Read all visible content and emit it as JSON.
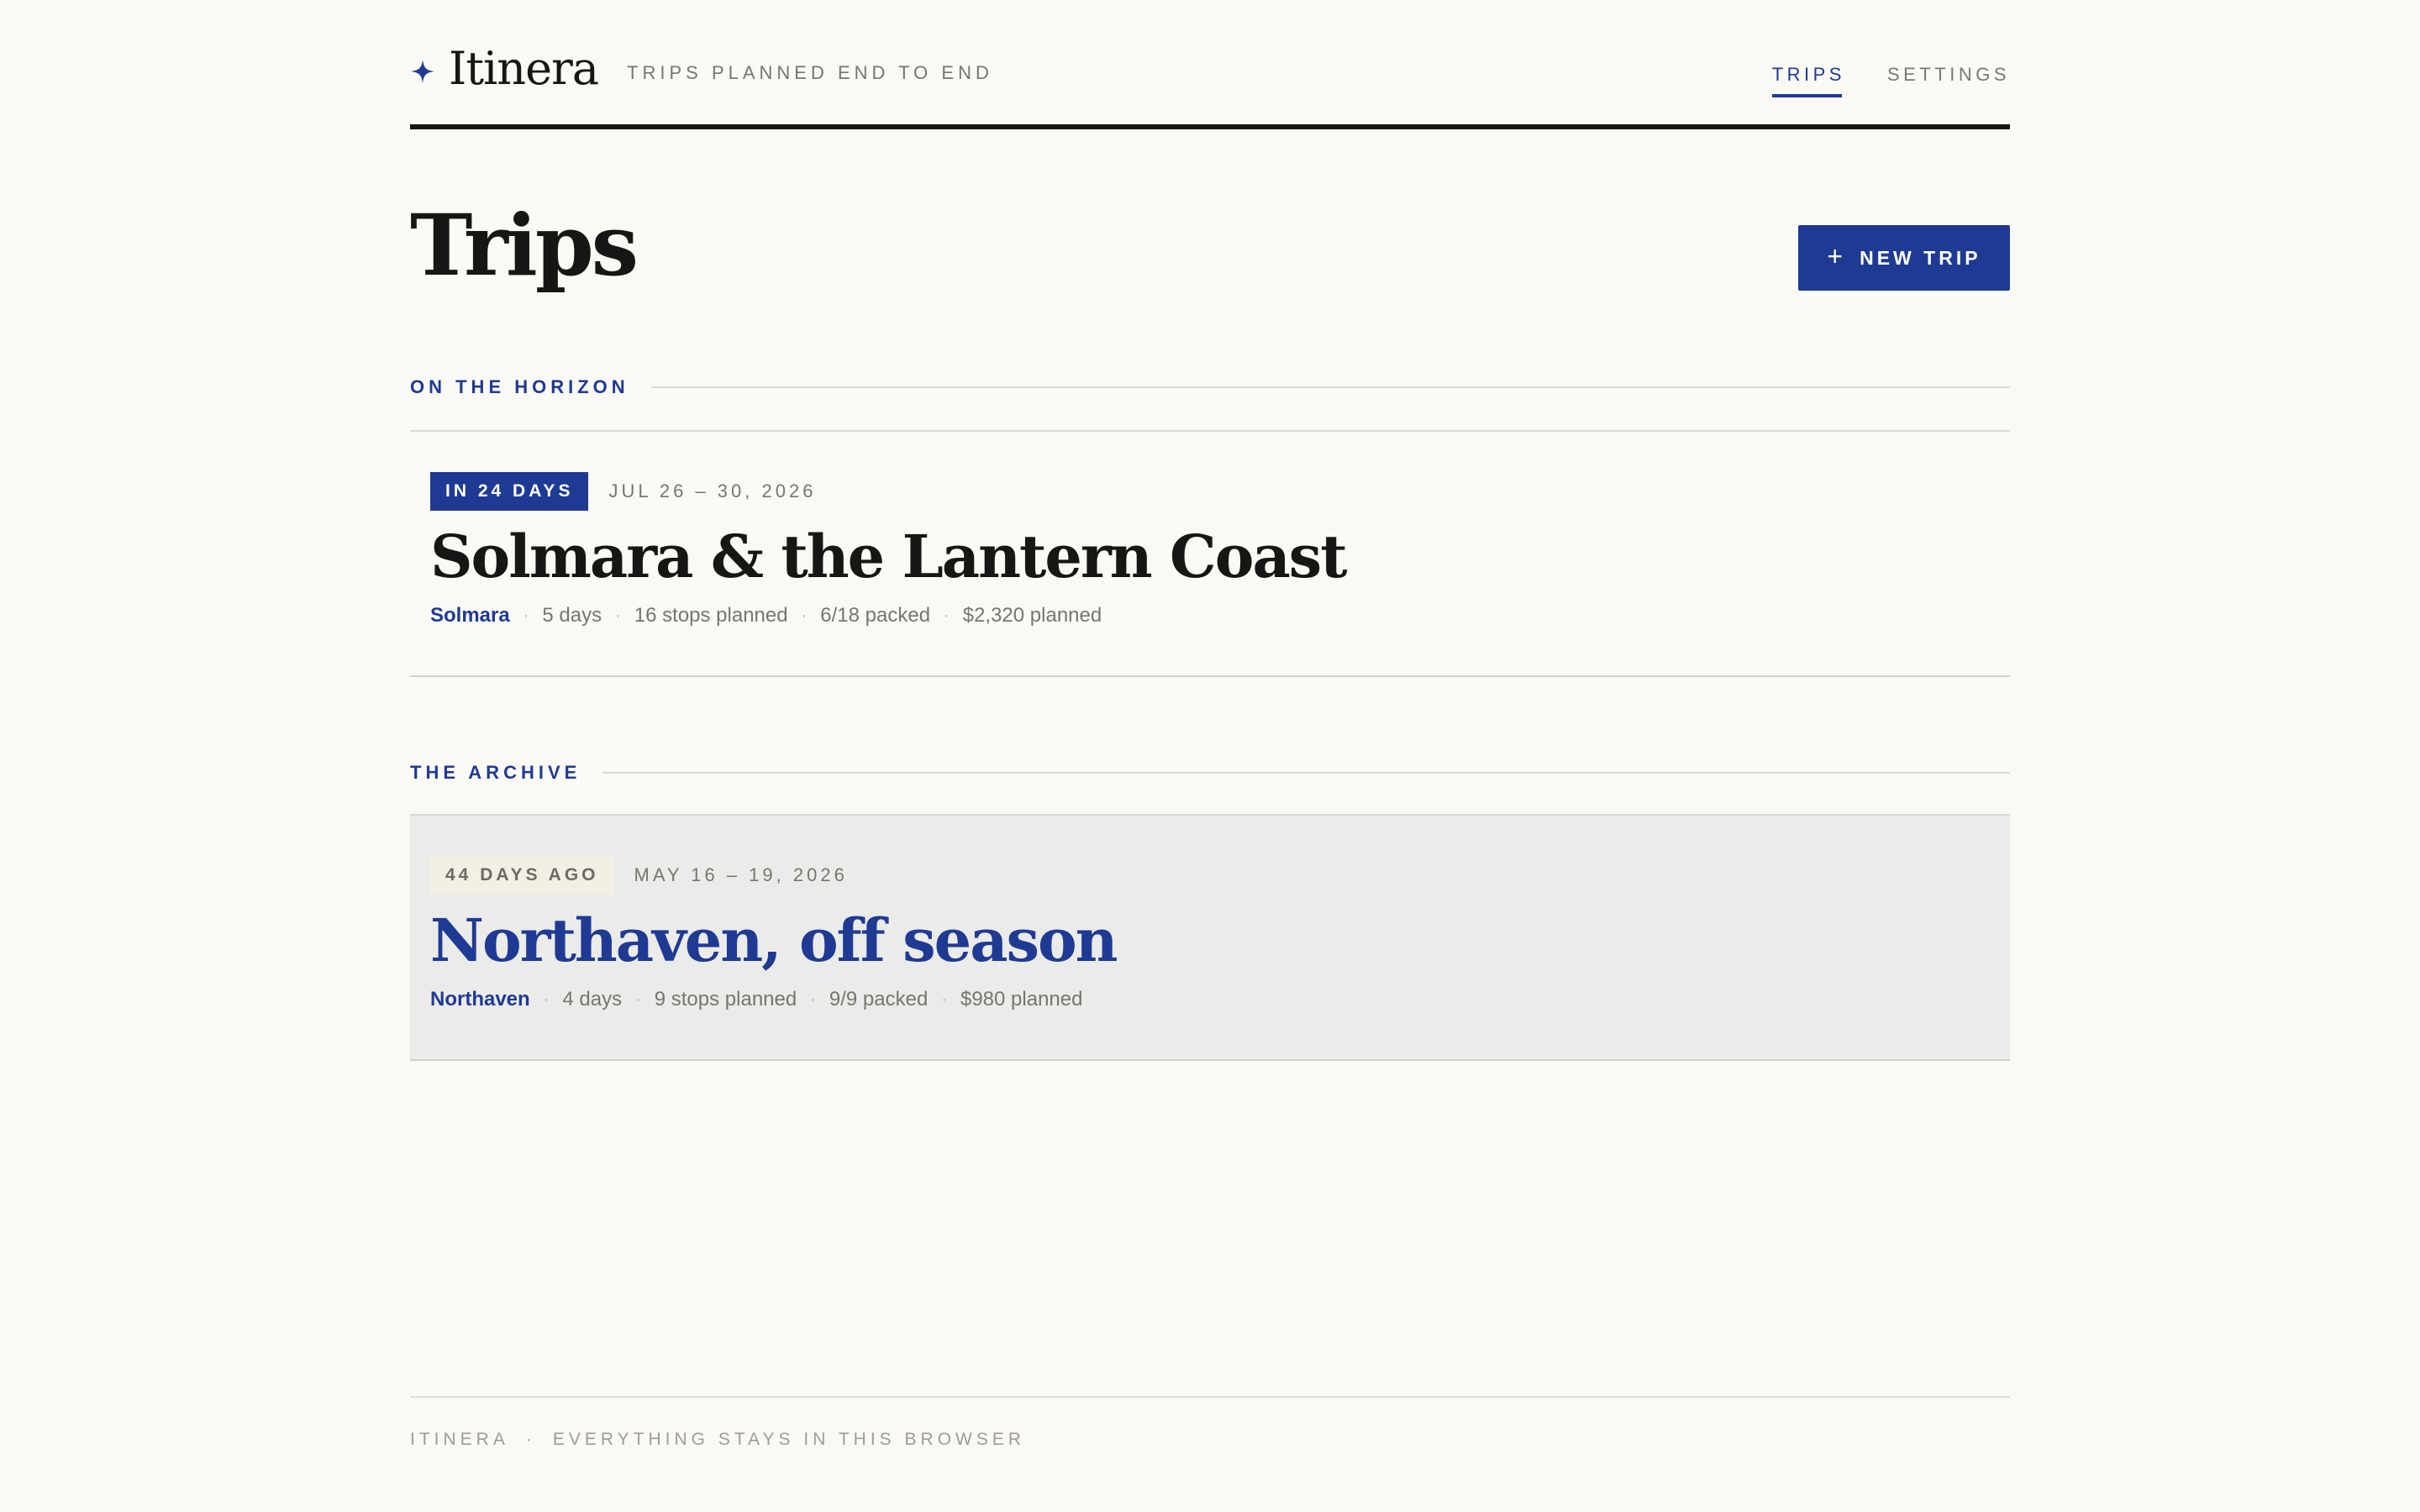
{
  "app": {
    "name": "Itinera",
    "tagline": "TRIPS PLANNED END TO END",
    "logo_icon": "four-point-star-icon",
    "accent_color": "#1f3a93",
    "background_color": "#faf9f4"
  },
  "nav": {
    "items": [
      {
        "label": "TRIPS",
        "active": true
      },
      {
        "label": "SETTINGS",
        "active": false
      }
    ]
  },
  "page": {
    "title": "Trips",
    "new_trip_icon": "plus-icon",
    "new_trip_symbol": "+",
    "new_trip_label": "NEW TRIP"
  },
  "sections": {
    "upcoming": {
      "label": "ON THE HORIZON",
      "trip": {
        "countdown": "IN 24 DAYS",
        "dates": "JUL 26 – 30, 2026",
        "name": "Solmara & the Lantern Coast",
        "destination": "Solmara",
        "days": "5 days",
        "stops": "16 stops planned",
        "packed": "6/18 packed",
        "budget": "$2,320 planned"
      }
    },
    "archive": {
      "label": "THE ARCHIVE",
      "trip": {
        "countdown": "44 DAYS AGO",
        "dates": "MAY 16 – 19, 2026",
        "name": "Northaven, off season",
        "destination": "Northaven",
        "days": "4 days",
        "stops": "9 stops planned",
        "packed": "9/9 packed",
        "budget": "$980 planned"
      }
    }
  },
  "footer": {
    "brand": "ITINERA",
    "separator": "·",
    "note": "EVERYTHING STAYS IN THIS BROWSER"
  }
}
